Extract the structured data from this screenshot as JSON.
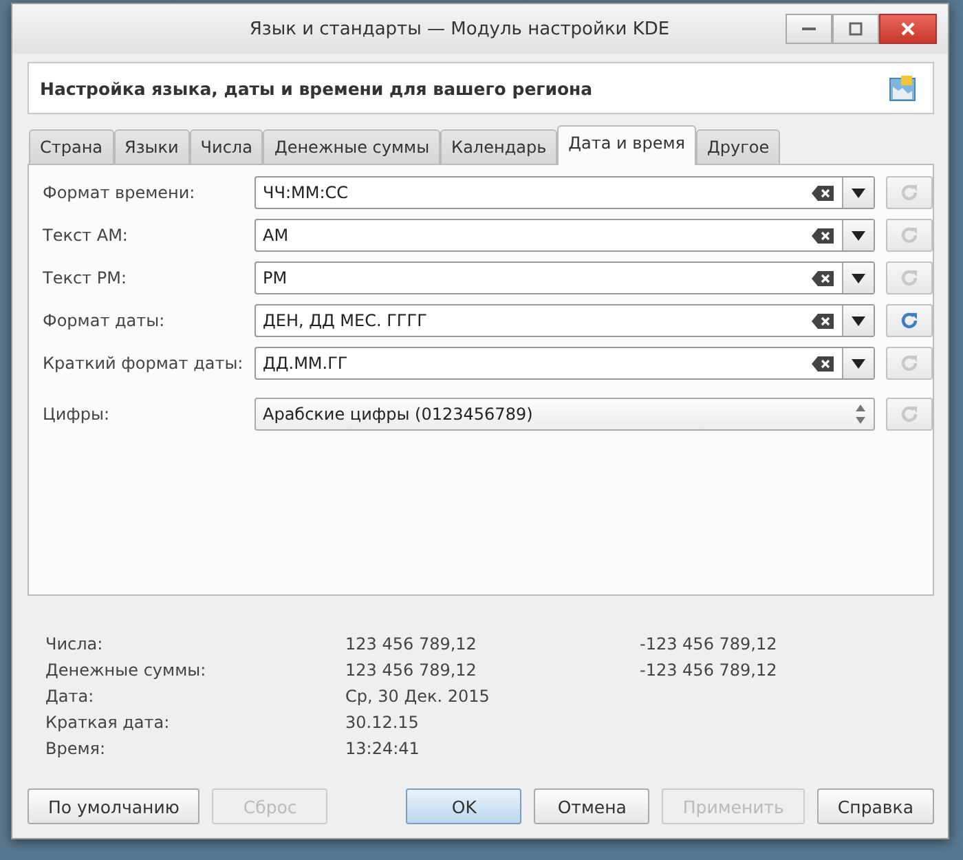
{
  "window": {
    "title": "Язык и стандарты — Модуль настройки KDE"
  },
  "header": {
    "title": "Настройка языка, даты и времени для вашего региона"
  },
  "tabs": [
    {
      "label": "Страна",
      "selected": false
    },
    {
      "label": "Языки",
      "selected": false
    },
    {
      "label": "Числа",
      "selected": false
    },
    {
      "label": "Денежные суммы",
      "selected": false
    },
    {
      "label": "Календарь",
      "selected": false
    },
    {
      "label": "Дата и время",
      "selected": true
    },
    {
      "label": "Другое",
      "selected": false
    }
  ],
  "fields": [
    {
      "label": "Формат времени:",
      "kind": "combo",
      "value": "ЧЧ:ММ:СС",
      "reset_enabled": false
    },
    {
      "label": "Текст AM:",
      "kind": "combo",
      "value": "AM",
      "reset_enabled": false
    },
    {
      "label": "Текст PM:",
      "kind": "combo",
      "value": "PM",
      "reset_enabled": false
    },
    {
      "label": "Формат даты:",
      "kind": "combo",
      "value": "ДЕН, ДД МЕС. ГГГГ",
      "reset_enabled": true
    },
    {
      "label": "Краткий формат даты:",
      "kind": "combo",
      "value": "ДД.ММ.ГГ",
      "reset_enabled": false
    },
    {
      "label": "Цифры:",
      "kind": "select",
      "value": "Арабские цифры (0123456789)",
      "reset_enabled": false
    }
  ],
  "preview": [
    {
      "label": "Числа:",
      "positive": "123 456 789,12",
      "negative": "-123 456 789,12"
    },
    {
      "label": "Денежные суммы:",
      "positive": "123 456 789,12",
      "negative": "-123 456 789,12"
    },
    {
      "label": "Дата:",
      "positive": "Ср, 30 Дек. 2015"
    },
    {
      "label": "Краткая дата:",
      "positive": "30.12.15"
    },
    {
      "label": "Время:",
      "positive": "13:24:41"
    }
  ],
  "buttons_left": [
    {
      "label": "По умолчанию",
      "disabled": false,
      "default": false
    },
    {
      "label": "Сброс",
      "disabled": true,
      "default": false
    }
  ],
  "buttons_right": [
    {
      "label": "OK",
      "disabled": false,
      "default": true
    },
    {
      "label": "Отмена",
      "disabled": false,
      "default": false
    },
    {
      "label": "Применить",
      "disabled": true,
      "default": false
    },
    {
      "label": "Справка",
      "disabled": false,
      "default": false
    }
  ]
}
